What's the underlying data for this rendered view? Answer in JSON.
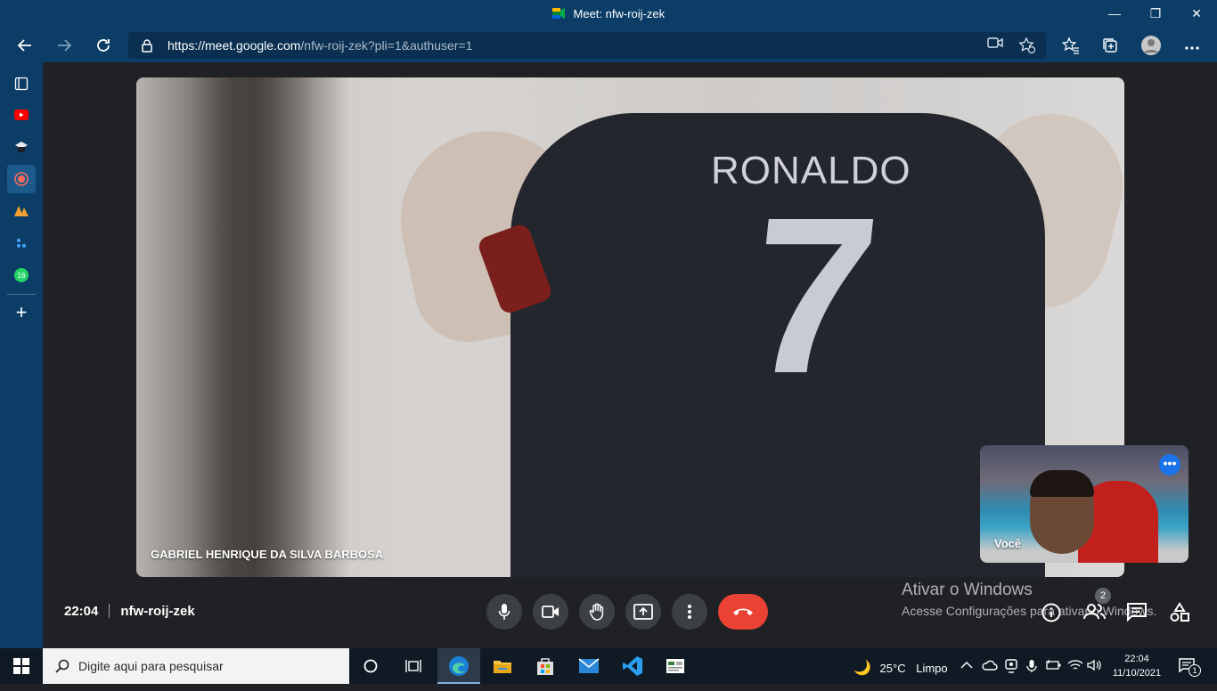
{
  "window": {
    "title": "Meet: nfw-roij-zek",
    "minimize_glyph": "—",
    "restore_glyph": "❐",
    "close_glyph": "✕"
  },
  "browser": {
    "url_host": "https://meet.google.com",
    "url_path": "/nfw-roij-zek?pli=1&authuser=1",
    "icons": [
      "back-icon",
      "forward-icon",
      "refresh-icon",
      "lock-icon",
      "camera-icon",
      "add-favorite-icon",
      "favorites-icon",
      "collections-icon",
      "profile-icon",
      "more-icon"
    ]
  },
  "sidebar": {
    "items": [
      {
        "name": "tab-actions-icon"
      },
      {
        "name": "youtube-icon",
        "color": "#ff0000"
      },
      {
        "name": "classroom-icon"
      },
      {
        "name": "record-icon",
        "color": "#ff6b5b"
      },
      {
        "name": "pwa-icon",
        "color": "#f0a030"
      },
      {
        "name": "app-icon",
        "color": "#4aa3ff"
      },
      {
        "name": "whatsapp-icon",
        "badge": "16",
        "color": "#25d366"
      }
    ],
    "add_glyph": "+"
  },
  "meet": {
    "participant_name": "GABRIEL HENRIQUE DA SILVA BARBOSA",
    "shirt_name": "RONALDO",
    "shirt_number": "7",
    "self_label": "Você",
    "self_more_glyph": "•••",
    "time": "22:04",
    "meeting_code": "nfw-roij-zek",
    "people_count": "2",
    "accent": "#1a73e8",
    "end_color": "#ea4335"
  },
  "watermark": {
    "line1": "Ativar o Windows",
    "line2": "Acesse Configurações para ativar o Windows."
  },
  "taskbar": {
    "search_placeholder": "Digite aqui para pesquisar",
    "weather_temp": "25°C",
    "weather_text": "Limpo",
    "clock_time": "22:04",
    "clock_date": "11/10/2021",
    "notif_count": "1"
  }
}
